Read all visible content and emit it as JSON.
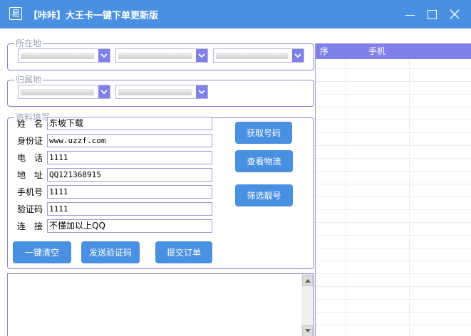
{
  "window": {
    "icon_char": "易",
    "title": "【咔咔】大王卡一键下单更新版"
  },
  "location_group": {
    "legend": "所在地"
  },
  "attribution_group": {
    "legend": "归属地"
  },
  "info_group": {
    "legend": "资料填写",
    "fields": [
      {
        "label": "姓　名",
        "value": "东坡下载"
      },
      {
        "label": "身份证",
        "value": "www.uzzf.com"
      },
      {
        "label": "电　话",
        "value": "1111"
      },
      {
        "label": "地　址",
        "value": "QQ121368915"
      },
      {
        "label": "手机号",
        "value": "1111"
      },
      {
        "label": "验证码",
        "value": "1111"
      },
      {
        "label": "连　接",
        "value": "不懂加以上QQ"
      }
    ],
    "side_buttons": [
      "获取号码",
      "查看物流",
      "筛选靓号"
    ],
    "bottom_buttons": [
      "一键清空",
      "发送验证码",
      "提交订单"
    ]
  },
  "result_table": {
    "columns": [
      "序",
      "手机"
    ]
  },
  "colors": {
    "titlebar": "#4a90e2",
    "button": "#4a90e2",
    "accent": "#8080ea",
    "border": "#8585e0"
  }
}
